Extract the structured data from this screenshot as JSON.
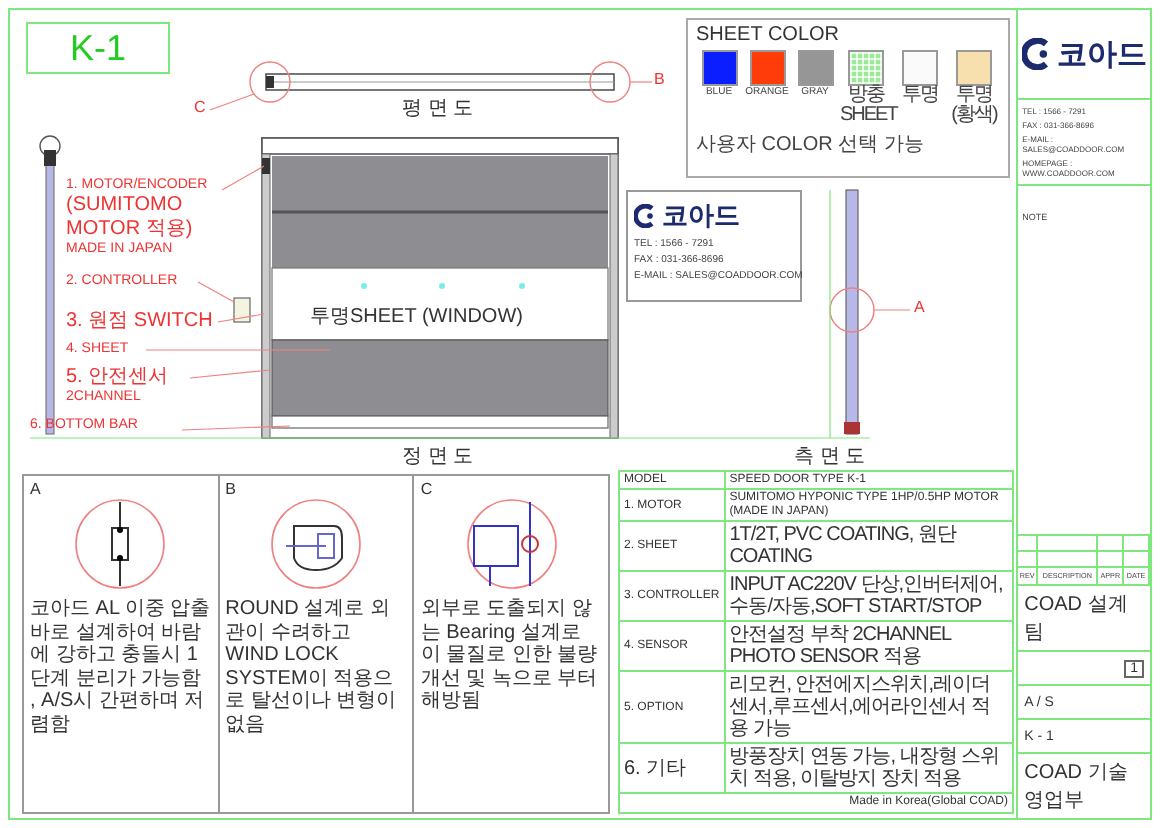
{
  "title": "K-1",
  "sheet_color": {
    "title": "SHEET COLOR",
    "note": "사용자 COLOR 선택 가능",
    "swatches": [
      {
        "label": "BLUE",
        "color": "#0a1eff",
        "kind": "solid"
      },
      {
        "label": "ORANGE",
        "color": "#ff3c0a",
        "kind": "solid"
      },
      {
        "label": "GRAY",
        "color": "#969696",
        "kind": "solid"
      },
      {
        "label": "방충SHEET",
        "color": "#9ee89a",
        "kind": "mesh"
      },
      {
        "label": "투명",
        "color": "#fafafa",
        "kind": "solid"
      },
      {
        "label": "투명(황색)",
        "color": "#f7dfae",
        "kind": "solid"
      }
    ]
  },
  "views": {
    "plan": "평 면 도",
    "front": "정 면 도",
    "side": "측 면 도"
  },
  "window_label": "투명SHEET (WINDOW)",
  "detail_marks": [
    "C",
    "B",
    "A"
  ],
  "callouts": [
    {
      "lines": [
        "1. MOTOR/ENCODER",
        "(SUMITOMO MOTOR 적용)",
        "MADE IN JAPAN"
      ]
    },
    {
      "lines": [
        "2. CONTROLLER"
      ]
    },
    {
      "lines": [
        "3. 원점 SWITCH"
      ]
    },
    {
      "lines": [
        "4. SHEET"
      ]
    },
    {
      "lines": [
        "5. 안전센서",
        "2CHANNEL"
      ]
    },
    {
      "lines": [
        "6. BOTTOM BAR"
      ]
    }
  ],
  "business_card": {
    "brand": "코아드",
    "lines": [
      "TEL : 1566 - 7291",
      "FAX : 031-366-8696",
      "E-MAIL : SALES@COADDOOR.COM"
    ]
  },
  "details": [
    {
      "label": "A",
      "text": "코아드 AL 이중 압출바로 설계하여 바람에 강하고 충돌시 1단계 분리가 가능함 , A/S시 간편하며 저렴함"
    },
    {
      "label": "B",
      "text": "ROUND 설계로 외관이 수려하고 WIND LOCK SYSTEM이 적용으로 탈선이나 변형이 없음"
    },
    {
      "label": "C",
      "text": "외부로 도출되지 않는 Bearing 설계로 이 물질로 인한 불량 개선 및 녹으로 부터 해방됨"
    }
  ],
  "spec": {
    "rows": [
      {
        "label": "MODEL",
        "value": "SPEED DOOR TYPE K-1"
      },
      {
        "label": "1. MOTOR",
        "value": "SUMITOMO HYPONIC TYPE 1HP/0.5HP MOTOR (MADE IN JAPAN)"
      },
      {
        "label": "2. SHEET",
        "value": "1T/2T, PVC COATING, 원단 COATING"
      },
      {
        "label": "3. CONTROLLER",
        "value": "INPUT AC220V 단상,인버터제어,수동/자동,SOFT START/STOP"
      },
      {
        "label": "4. SENSOR",
        "value": "안전설정 부착 2CHANNEL PHOTO SENSOR 적용"
      },
      {
        "label": "5. OPTION",
        "value": "리모컨, 안전에지스위치,레이더센서,루프센서,에어라인센서 적용 가능"
      },
      {
        "label": "6. 기타",
        "value": "방풍장치 연동 가능, 내장형 스위치 적용, 이탈방지 장치 적용"
      }
    ],
    "footer": "Made in Korea(Global COAD)"
  },
  "title_block": {
    "brand": "코아드",
    "contact": [
      "TEL : 1566 - 7291",
      "FAX : 031-366-8696",
      "E-MAIL : SALES@COADDOOR.COM",
      "HOMEPAGE : WWW.COADDOOR.COM"
    ],
    "note": "NOTE",
    "revision_columns": [
      "REV",
      "DESCRIPTION",
      "APPR",
      "DATE"
    ],
    "designer": "COAD 설계팀",
    "sheet_no": "1",
    "scale": "A / S",
    "drawing_no": "K - 1",
    "department": "COAD 기술영업부"
  }
}
